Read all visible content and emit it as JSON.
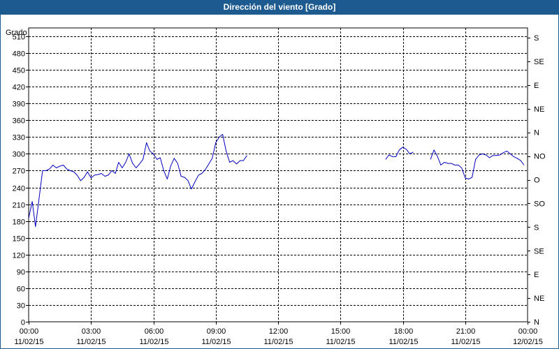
{
  "window": {
    "title": "Dirección del viento [Grado]"
  },
  "chart_data": {
    "type": "line",
    "title": "Dirección del viento [Grado]",
    "ylabel": "Grado",
    "xlabel": "",
    "ylim": [
      0,
      525
    ],
    "y_ticks": [
      0,
      30,
      60,
      90,
      120,
      150,
      180,
      210,
      240,
      270,
      300,
      330,
      360,
      390,
      420,
      450,
      480,
      510
    ],
    "right_axis_labels": [
      {
        "value": 0,
        "label": "N"
      },
      {
        "value": 45,
        "label": "NE"
      },
      {
        "value": 90,
        "label": "E"
      },
      {
        "value": 135,
        "label": "SE"
      },
      {
        "value": 180,
        "label": "S"
      },
      {
        "value": 225,
        "label": "SO"
      },
      {
        "value": 270,
        "label": "O"
      },
      {
        "value": 315,
        "label": "NO"
      },
      {
        "value": 360,
        "label": "N"
      },
      {
        "value": 405,
        "label": "NE"
      },
      {
        "value": 450,
        "label": "E"
      },
      {
        "value": 495,
        "label": "SE"
      },
      {
        "value": 540,
        "label": "S"
      }
    ],
    "x_range_hours": [
      0,
      24
    ],
    "x_ticks": [
      {
        "hour": 0,
        "time": "00:00",
        "date": "11/02/15"
      },
      {
        "hour": 3,
        "time": "03:00",
        "date": "11/02/15"
      },
      {
        "hour": 6,
        "time": "06:00",
        "date": "11/02/15"
      },
      {
        "hour": 9,
        "time": "09:00",
        "date": "11/02/15"
      },
      {
        "hour": 12,
        "time": "12:00",
        "date": "11/02/15"
      },
      {
        "hour": 15,
        "time": "15:00",
        "date": "11/02/15"
      },
      {
        "hour": 18,
        "time": "18:00",
        "date": "11/02/15"
      },
      {
        "hour": 21,
        "time": "21:00",
        "date": "11/02/15"
      },
      {
        "hour": 24,
        "time": "00:00",
        "date": "12/02/15"
      }
    ],
    "grid": true,
    "line_color": "#0000c0",
    "segments": [
      [
        [
          0.0,
          185
        ],
        [
          0.17,
          215
        ],
        [
          0.33,
          170
        ],
        [
          0.5,
          220
        ],
        [
          0.67,
          270
        ],
        [
          0.83,
          270
        ],
        [
          1.0,
          273
        ],
        [
          1.17,
          280
        ],
        [
          1.33,
          275
        ],
        [
          1.5,
          278
        ],
        [
          1.67,
          280
        ],
        [
          1.83,
          273
        ],
        [
          2.0,
          270
        ],
        [
          2.17,
          268
        ],
        [
          2.33,
          262
        ],
        [
          2.5,
          252
        ],
        [
          2.67,
          258
        ],
        [
          2.83,
          268
        ],
        [
          3.0,
          257
        ],
        [
          3.17,
          262
        ],
        [
          3.33,
          263
        ],
        [
          3.5,
          265
        ],
        [
          3.67,
          260
        ],
        [
          3.83,
          262
        ],
        [
          4.0,
          270
        ],
        [
          4.17,
          265
        ],
        [
          4.33,
          285
        ],
        [
          4.5,
          275
        ],
        [
          4.67,
          285
        ],
        [
          4.83,
          300
        ],
        [
          5.0,
          283
        ],
        [
          5.17,
          275
        ],
        [
          5.33,
          282
        ],
        [
          5.5,
          290
        ],
        [
          5.67,
          320
        ],
        [
          5.83,
          305
        ],
        [
          6.0,
          300
        ],
        [
          6.17,
          290
        ],
        [
          6.33,
          293
        ],
        [
          6.5,
          270
        ],
        [
          6.67,
          255
        ],
        [
          6.83,
          278
        ],
        [
          7.0,
          292
        ],
        [
          7.17,
          283
        ],
        [
          7.33,
          260
        ],
        [
          7.5,
          258
        ],
        [
          7.67,
          252
        ],
        [
          7.83,
          237
        ],
        [
          8.0,
          250
        ],
        [
          8.17,
          262
        ],
        [
          8.33,
          265
        ],
        [
          8.5,
          272
        ],
        [
          8.67,
          282
        ],
        [
          8.83,
          292
        ],
        [
          9.0,
          320
        ],
        [
          9.17,
          330
        ],
        [
          9.33,
          335
        ],
        [
          9.5,
          305
        ],
        [
          9.67,
          285
        ],
        [
          9.83,
          288
        ],
        [
          10.0,
          282
        ],
        [
          10.17,
          288
        ],
        [
          10.33,
          288
        ],
        [
          10.5,
          297
        ]
      ],
      [
        [
          17.17,
          290
        ],
        [
          17.33,
          298
        ],
        [
          17.5,
          295
        ],
        [
          17.67,
          295
        ],
        [
          17.83,
          307
        ],
        [
          18.0,
          312
        ],
        [
          18.17,
          308
        ],
        [
          18.33,
          300
        ],
        [
          18.5,
          303
        ]
      ],
      [
        [
          19.33,
          290
        ],
        [
          19.5,
          307
        ],
        [
          19.67,
          295
        ],
        [
          19.83,
          280
        ],
        [
          20.0,
          285
        ],
        [
          20.17,
          283
        ],
        [
          20.33,
          283
        ],
        [
          20.5,
          280
        ],
        [
          20.67,
          280
        ],
        [
          20.83,
          275
        ],
        [
          21.0,
          257
        ],
        [
          21.17,
          255
        ],
        [
          21.33,
          258
        ],
        [
          21.5,
          290
        ],
        [
          21.67,
          298
        ],
        [
          21.83,
          300
        ],
        [
          22.0,
          298
        ],
        [
          22.17,
          293
        ],
        [
          22.33,
          297
        ],
        [
          22.5,
          297
        ],
        [
          22.67,
          298
        ],
        [
          22.83,
          302
        ],
        [
          23.0,
          305
        ],
        [
          23.17,
          300
        ],
        [
          23.33,
          295
        ],
        [
          23.5,
          292
        ],
        [
          23.67,
          288
        ],
        [
          23.83,
          280
        ]
      ]
    ]
  }
}
